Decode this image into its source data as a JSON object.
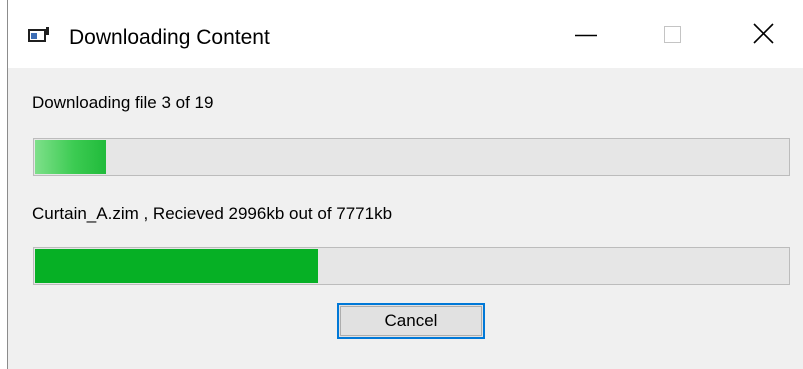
{
  "window": {
    "title": "Downloading Content",
    "controls": {
      "minimize": "minimize-icon",
      "maximize": "maximize-icon",
      "close": "close-icon"
    }
  },
  "overall": {
    "label": "Downloading file 3 of 19",
    "progress_fraction": 0.097
  },
  "file": {
    "label": "Curtain_A.zim , Recieved 2996kb out of 7771kb",
    "progress_fraction": 0.378
  },
  "actions": {
    "cancel_label": "Cancel"
  },
  "colors": {
    "accent": "#0078d7",
    "progress_green": "#06b025",
    "track": "#e6e6e6"
  }
}
